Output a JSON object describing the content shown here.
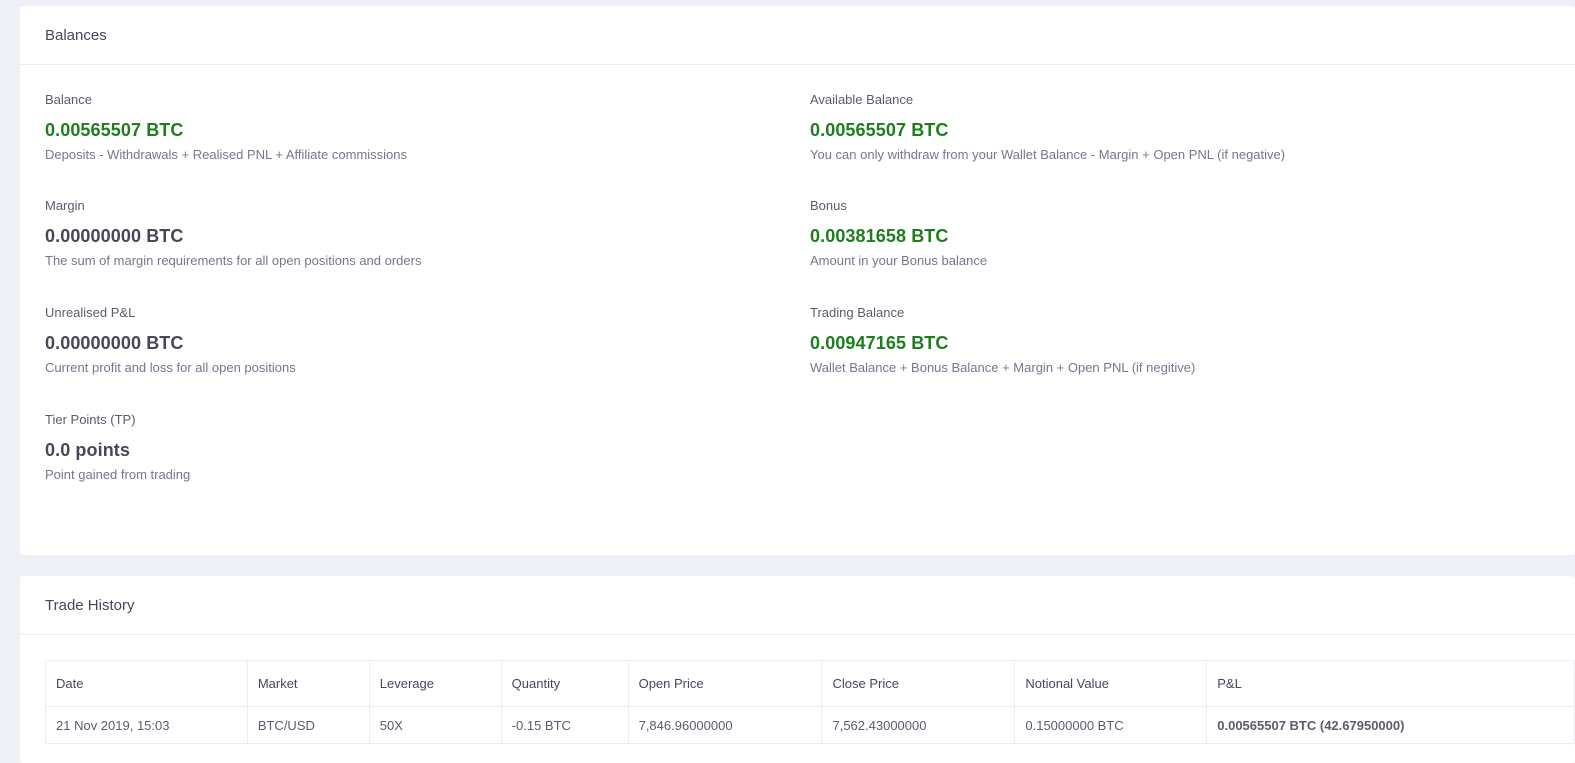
{
  "balances": {
    "title": "Balances",
    "items": [
      {
        "label": "Balance",
        "value": "0.00565507 BTC",
        "desc": "Deposits - Withdrawals + Realised PNL + Affiliate commissions"
      },
      {
        "label": "Available Balance",
        "value": "0.00565507 BTC",
        "desc": "You can only withdraw from your Wallet Balance - Margin + Open PNL (if negative)"
      },
      {
        "label": "Margin",
        "value": "0.00000000 BTC",
        "desc": "The sum of margin requirements for all open positions and orders"
      },
      {
        "label": "Bonus",
        "value": "0.00381658 BTC",
        "desc": "Amount in your Bonus balance"
      },
      {
        "label": "Unrealised P&L",
        "value": "0.00000000 BTC",
        "desc": "Current profit and loss for all open positions"
      },
      {
        "label": "Trading Balance",
        "value": "0.00947165 BTC",
        "desc": "Wallet Balance + Bonus Balance + Margin + Open PNL (if negitive)"
      },
      {
        "label": "Tier Points (TP)",
        "value": "0.0 points",
        "desc": "Point gained from trading"
      }
    ]
  },
  "trade_history": {
    "title": "Trade History",
    "columns": [
      "Date",
      "Market",
      "Leverage",
      "Quantity",
      "Open Price",
      "Close Price",
      "Notional Value",
      "P&L"
    ],
    "rows": [
      [
        "21 Nov 2019, 15:03",
        "BTC/USD",
        "50X",
        "-0.15 BTC",
        "7,846.96000000",
        "7,562.43000000",
        "0.15000000 BTC",
        "0.00565507 BTC (42.67950000)"
      ]
    ]
  },
  "colors": {
    "positive": "#1e7e1e",
    "neutral": "#48465b",
    "background": "#eff0f5"
  }
}
